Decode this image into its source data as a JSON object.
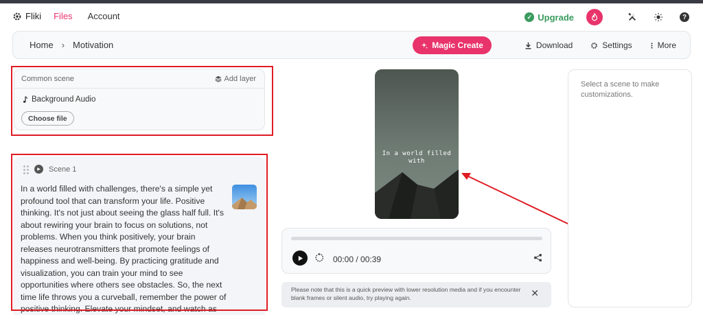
{
  "nav": {
    "brand": "Fliki",
    "links": [
      {
        "label": "Files",
        "active": true
      },
      {
        "label": "Account",
        "active": false
      }
    ],
    "upgrade_label": "Upgrade",
    "icons": [
      "tools-icon",
      "theme-sun-icon",
      "help-icon"
    ]
  },
  "breadcrumb": {
    "home": "Home",
    "separator": "›",
    "current": "Motivation"
  },
  "toolbar": {
    "magic_create": "Magic Create",
    "download": "Download",
    "settings": "Settings",
    "more": "More"
  },
  "common_scene": {
    "title": "Common scene",
    "add_layer": "Add layer",
    "background_audio": "Background Audio",
    "choose_file": "Choose file"
  },
  "scene": {
    "title": "Scene 1",
    "text": "In a world filled with challenges, there's a simple yet profound tool that can transform your life. Positive thinking. It's not just about seeing the glass half full. It's about rewiring your brain to focus on solutions, not problems. When you think positively, your brain releases neurotransmitters that promote feelings of happiness and well-being. By practicing gratitude and visualization, you can train your mind to see opportunities where others see obstacles. So, the next time life throws you a curveball, remember the power of positive thinking. Elevate your mindset, and watch as your life transforms before your eyes."
  },
  "preview": {
    "caption": "In a world filled with"
  },
  "player": {
    "time": "00:00 / 00:39",
    "progress": 0
  },
  "note": {
    "text": "Please note that this is a quick preview with lower resolution media and if you encounter blank frames or silent audio, try playing again."
  },
  "customization": {
    "placeholder": "Select a scene to make customizations."
  },
  "colors": {
    "accent": "#e8336b",
    "upgrade": "#3a9b5e",
    "annotation": "#e01b24"
  }
}
